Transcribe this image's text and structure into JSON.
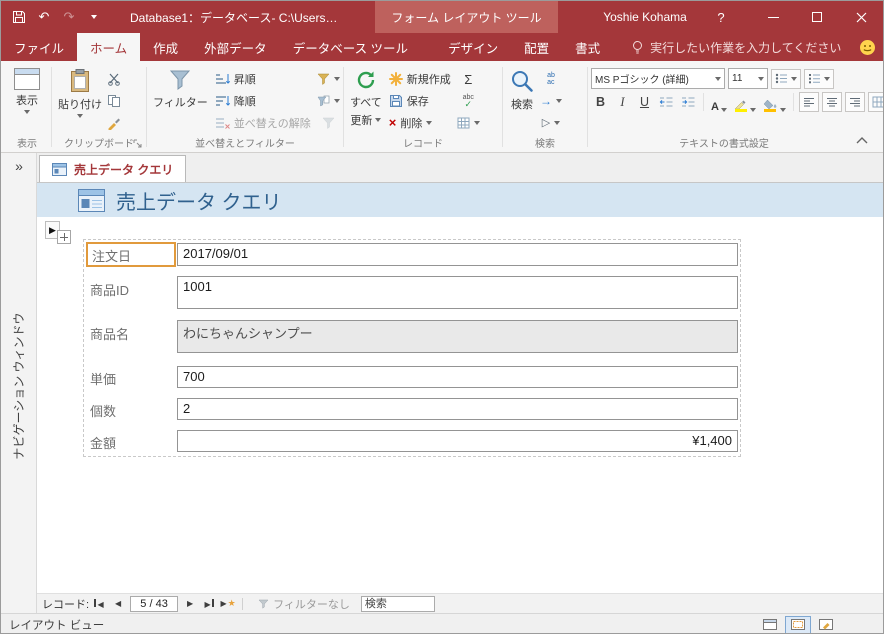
{
  "colors": {
    "accent_red": "#A4373A",
    "contextual_tab": "#BE615D",
    "header_band": "#D5E5F2",
    "header_title": "#30618E",
    "selection_orange": "#E19A3C"
  },
  "titlebar": {
    "title": "Database1：データベース- C:\\Users…",
    "contextual": "フォーム レイアウト ツール",
    "user": "Yoshie Kohama",
    "help": "?"
  },
  "tabs": {
    "file": "ファイル",
    "home": "ホーム",
    "create": "作成",
    "external_data": "外部データ",
    "database_tools": "データベース ツール",
    "design": "デザイン",
    "arrange": "配置",
    "format": "書式",
    "tellme": "実行したい作業を入力してください"
  },
  "ribbon": {
    "view_group": {
      "button": "表示",
      "group_label": "表示"
    },
    "clipboard": {
      "paste": "貼り付け",
      "group_label": "クリップボード"
    },
    "sort_filter": {
      "filter": "フィルター",
      "ascending": "昇順",
      "descending": "降順",
      "remove_sort": "並べ替えの解除",
      "group_label": "並べ替えとフィルター"
    },
    "records": {
      "refresh_line1": "すべて",
      "refresh_line2": "更新",
      "new": "新規作成",
      "save": "保存",
      "delete": "削除",
      "group_label": "レコード"
    },
    "find": {
      "find": "検索",
      "group_label": "検索"
    },
    "text_format": {
      "font_name": "MS Pゴシック (詳細)",
      "font_size": "11",
      "bold": "B",
      "italic": "I",
      "underline": "U",
      "group_label": "テキストの書式設定"
    }
  },
  "icons": {
    "undo": "↶",
    "redo": "↷",
    "expand_nav": "»",
    "sigma": "Σ",
    "delete_x": "×",
    "check": "✓",
    "abc": "abc",
    "replace_top": "ab",
    "replace_bottom": "ac",
    "goto_arrow": "→",
    "select_arrow": "▷",
    "font_color_a": "A",
    "nav_prev": "◀",
    "nav_next": "▶",
    "record_arrow": "▶",
    "new_star": "★"
  },
  "document": {
    "tab_label": "売上データ クエリ",
    "header_title": "売上データ クエリ"
  },
  "nav_pane": {
    "vertical_label": "ナビゲーション ウィンドウ"
  },
  "form": {
    "fields": [
      {
        "label": "注文日",
        "value": "2017/09/01"
      },
      {
        "label": "商品ID",
        "value": "1001"
      },
      {
        "label": "商品名",
        "value": "わにちゃんシャンプー"
      },
      {
        "label": "単価",
        "value": "700"
      },
      {
        "label": "個数",
        "value": "2"
      },
      {
        "label": "金額",
        "value": "¥1,400"
      }
    ]
  },
  "record_nav": {
    "label": "レコード:",
    "position": "5 / 43",
    "filter_status": "フィルターなし",
    "search_placeholder": "検索"
  },
  "status_bar": {
    "view_label": "レイアウト ビュー"
  }
}
